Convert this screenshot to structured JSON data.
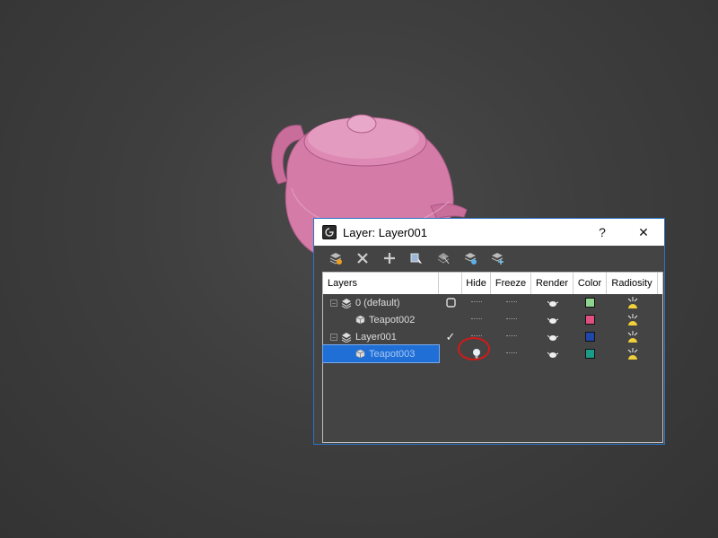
{
  "dialog": {
    "title": "Layer: Layer001",
    "help_label": "?",
    "close_label": "✕"
  },
  "toolbar": {
    "tools": [
      "create-layer",
      "delete",
      "add-selected",
      "select-objects",
      "highlight-selected",
      "hide-all",
      "freeze-all"
    ]
  },
  "columns": {
    "layers": "Layers",
    "current": "",
    "hide": "Hide",
    "freeze": "Freeze",
    "render": "Render",
    "color": "Color",
    "radiosity": "Radiosity"
  },
  "rows": [
    {
      "name": "0 (default)",
      "type": "layer",
      "expander": "−",
      "color": "#8ed48e"
    },
    {
      "name": "Teapot002",
      "type": "object",
      "color": "#e0507f"
    },
    {
      "name": "Layer001",
      "type": "layer",
      "expander": "−",
      "current": "✓",
      "color": "#1f47a8"
    },
    {
      "name": "Teapot003",
      "type": "object",
      "selected": true,
      "hidden": true,
      "color": "#1a9c88"
    }
  ],
  "colors": {
    "accent": "#2a73c4",
    "selection": "#1f6fd6",
    "highlight_circle": "#d11a1a",
    "teapot": "#d57ba8"
  }
}
